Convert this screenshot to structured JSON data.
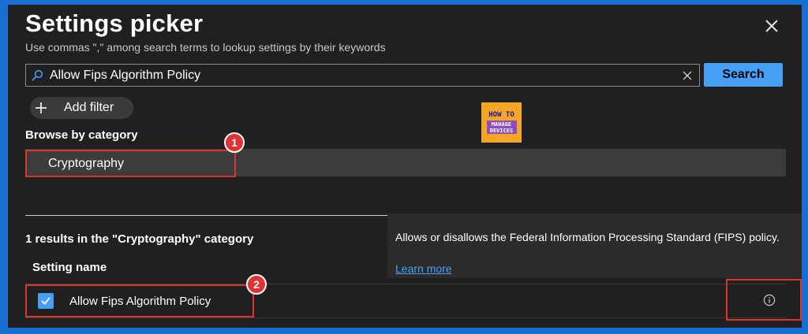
{
  "dialog": {
    "title": "Settings picker",
    "subtitle": "Use commas \",\" among search terms to lookup settings by their keywords",
    "close_icon": "close-icon"
  },
  "search": {
    "value": "Allow Fips Algorithm Policy",
    "button_label": "Search",
    "search_icon": "search-icon",
    "clear_icon": "clear-icon"
  },
  "filter": {
    "add_label": "Add filter",
    "icon": "plus-icon"
  },
  "logo": {
    "line1": "HOW TO",
    "line2": "MANAGE",
    "line3": "DEVICES"
  },
  "browse": {
    "label": "Browse by category",
    "selected_category": "Cryptography"
  },
  "annotations": {
    "badge1": "1",
    "badge2": "2"
  },
  "results": {
    "summary": "1 results in the \"Cryptography\" category",
    "column_header": "Setting name",
    "rows": [
      {
        "name": "Allow Fips Algorithm Policy",
        "checked": true
      }
    ]
  },
  "tooltip": {
    "text": "Allows or disallows the Federal Information Processing Standard (FIPS) policy.",
    "link": "Learn more"
  },
  "colors": {
    "accent": "#479ef5",
    "highlight": "#e03232",
    "frame": "#1a6fd4",
    "panel_bg": "#202020"
  }
}
